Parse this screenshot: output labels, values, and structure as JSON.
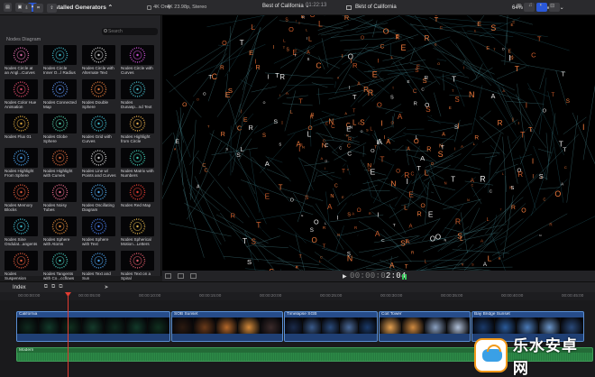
{
  "toolbar": {
    "generator_select": "Installed Generators",
    "fourk_only": "4K Only",
    "viewer_format": "4K 23.98p, Stereo",
    "viewer_title": "Best of California",
    "zoom": "64%",
    "view": "View"
  },
  "browser": {
    "search_placeholder": "Search",
    "section_title": "Nodes Diagram",
    "items": [
      {
        "label1": "Nodes Circle at",
        "label2": "an Angl...Curves",
        "color": "#d86aa6"
      },
      {
        "label1": "Nodes Circle",
        "label2": "Inner O...l Radius",
        "color": "#3fb8c9"
      },
      {
        "label1": "Nodes Circle with",
        "label2": "Alternate Text",
        "color": "#c9c9c9"
      },
      {
        "label1": "Nodes Circle with",
        "label2": "Curves",
        "color": "#c64fd0"
      },
      {
        "label1": "Nodes Color Hue",
        "label2": "Animation",
        "color": "#e04a6a"
      },
      {
        "label1": "Nodes Connected",
        "label2": "Map",
        "color": "#5a8ee8"
      },
      {
        "label1": "Nodes Double",
        "label2": "Sphere",
        "color": "#e07a3a"
      },
      {
        "label1": "Nodes",
        "label2": "Dunasp...nd Text",
        "color": "#46b9c7"
      },
      {
        "label1": "Nodes Flux 01",
        "label2": "",
        "color": "#d4a23a"
      },
      {
        "label1": "Nodes Globe",
        "label2": "Sphere",
        "color": "#4ec3a1"
      },
      {
        "label1": "Nodes Grid with",
        "label2": "Curves",
        "color": "#3fb8c9"
      },
      {
        "label1": "Nodes Highlight",
        "label2": "from Circle",
        "color": "#e0a84a"
      },
      {
        "label1": "Nodes Highlight",
        "label2": "From Sphere",
        "color": "#4a9ee8"
      },
      {
        "label1": "Nodes Highlight",
        "label2": "with Curves",
        "color": "#d96a3a"
      },
      {
        "label1": "Nodes Line w/",
        "label2": "Points and Curves",
        "color": "#cfcfcf"
      },
      {
        "label1": "Nodes Matrix with",
        "label2": "Numbers",
        "color": "#3fc9b0"
      },
      {
        "label1": "Nodes Memory",
        "label2": "Blocks",
        "color": "#e05a3a"
      },
      {
        "label1": "Nodes Noisy",
        "label2": "Tubes",
        "color": "#e86a8a"
      },
      {
        "label1": "Nodes Oscillating",
        "label2": "Diagram",
        "color": "#4ea6e8"
      },
      {
        "label1": "Nodes Red Map",
        "label2": "",
        "color": "#e23c32"
      },
      {
        "label1": "Nodes Sine",
        "label2": "Ondulat...angents",
        "color": "#3fb8c9"
      },
      {
        "label1": "Nodes Sphere",
        "label2": "with Atoms",
        "color": "#e08a3a"
      },
      {
        "label1": "Nodes Sphere",
        "label2": "with Text",
        "color": "#4a7ee8"
      },
      {
        "label1": "Nodes Spherical",
        "label2": "Motion...Letters",
        "color": "#d9b04a"
      },
      {
        "label1": "Nodes",
        "label2": "Suspension",
        "color": "#e05a3a"
      },
      {
        "label1": "Nodes Tangents",
        "label2": "with Co...ccflows",
        "color": "#46c7b9"
      },
      {
        "label1": "Nodes Text and",
        "label2": "Sun",
        "color": "#4a9ee8"
      },
      {
        "label1": "Nodes Text on a",
        "label2": "Spiral",
        "color": "#e05a6a"
      }
    ]
  },
  "viewer_controls": {
    "play": "▶",
    "timecode_dim": "00:00:0",
    "timecode_bright": "2:04"
  },
  "timeline": {
    "index": "Index",
    "project": "Best of California",
    "duration": "01:22:13",
    "ticks": [
      "00:00:00:00",
      "00:00:05:00",
      "00:00:10:00",
      "00:00:15:00",
      "00:00:20:00",
      "00:00:25:00",
      "00:00:30:00",
      "00:00:35:00",
      "00:00:40:00",
      "00:00:45:00"
    ],
    "clips": [
      {
        "name": "California",
        "colors": [
          "#0f2a1e",
          "#123a2a",
          "#10301f",
          "#153b2b",
          "#0f2a1e",
          "#123a2a",
          "#10301f"
        ]
      },
      {
        "name": "SOB Sunset",
        "colors": [
          "#2b1a10",
          "#6a3a1a",
          "#b5682a",
          "#d48a3a",
          "#3a2a2a"
        ]
      },
      {
        "name": "Timelapse SGB",
        "colors": [
          "#1a2a4a",
          "#3a5a8a",
          "#2a4a7a",
          "#4a6a9a",
          "#1a3a6a"
        ]
      },
      {
        "name": "Coit Tower",
        "colors": [
          "#e4a050",
          "#d08a40",
          "#8aa0c0",
          "#b0c0d8"
        ]
      },
      {
        "name": "Bay Bridge Sunset",
        "colors": [
          "#1a3a6a",
          "#2a5a9a",
          "#4a7ab8",
          "#6a94c8",
          "#2a4a7a"
        ]
      }
    ],
    "connected_clip": "Modern"
  },
  "watermark": "乐水安卓网"
}
